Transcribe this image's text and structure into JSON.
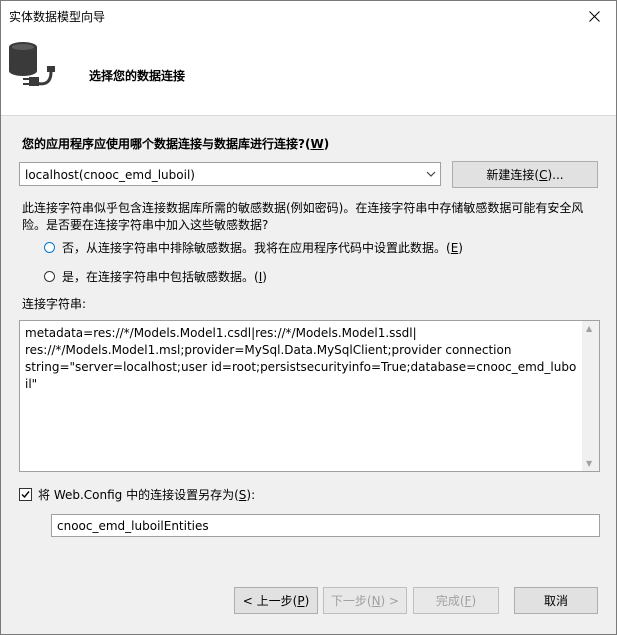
{
  "window": {
    "title": "实体数据模型向导"
  },
  "header": {
    "title": "选择您的数据连接",
    "icon": "database-plug-icon"
  },
  "question": {
    "text": "您的应用程序应使用哪个数据连接与数据库进行连接?(",
    "key": "W",
    "suffix": ")"
  },
  "connection_select": {
    "value": "localhost(cnooc_emd_luboil)"
  },
  "new_connection_button": {
    "label": "新建连接(",
    "key": "C",
    "suffix": ")..."
  },
  "sensitive_warning": "此连接字符串似乎包含连接数据库所需的敏感数据(例如密码)。在连接字符串中存储敏感数据可能有安全风险。是否要在连接字符串中加入这些敏感数据?",
  "options": [
    {
      "text": "否，从连接字符串中排除敏感数据。我将在应用程序代码中设置此数据。(",
      "key": "E",
      "suffix": ")",
      "selected": true
    },
    {
      "text": "是，在连接字符串中包括敏感数据。(",
      "key": "I",
      "suffix": ")",
      "selected": false
    }
  ],
  "connection_string": {
    "label": "连接字符串:",
    "value": "metadata=res://*/Models.Model1.csdl|res://*/Models.Model1.ssdl|\nres://*/Models.Model1.msl;provider=MySql.Data.MySqlClient;provider connection\nstring=\"server=localhost;user id=root;persistsecurityinfo=True;database=cnooc_emd_luboil\""
  },
  "save_config": {
    "text": "将 Web.Config 中的连接设置另存为(",
    "key": "S",
    "suffix": "):",
    "checked": true
  },
  "entity_name": {
    "value": "cnooc_emd_luboilEntities"
  },
  "buttons": {
    "back": {
      "label": "< 上一步(",
      "key": "P",
      "suffix": ")"
    },
    "next": {
      "label": "下一步(",
      "key": "N",
      "suffix": ") >"
    },
    "finish": {
      "label": "完成(",
      "key": "F",
      "suffix": ")"
    },
    "cancel": {
      "label": "取消"
    }
  },
  "colors": {
    "accent": "#0078d7",
    "dialog_bg": "#f0f0f0"
  }
}
